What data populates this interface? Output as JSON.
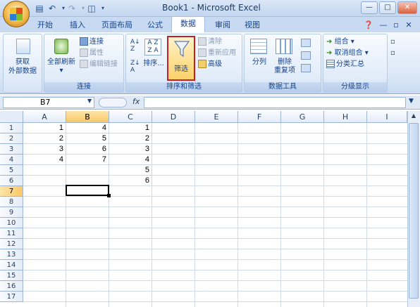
{
  "window": {
    "title": "Book1 - Microsoft Excel"
  },
  "qat": {
    "save_icon": "save-icon",
    "undo_icon": "undo-icon",
    "redo_icon": "redo-icon",
    "preview_icon": "print-preview-icon"
  },
  "tabs": [
    "开始",
    "插入",
    "页面布局",
    "公式",
    "数据",
    "审阅",
    "视图"
  ],
  "active_tab": "数据",
  "ribbon": {
    "get_external": {
      "label_line1": "获取",
      "label_line2": "外部数据"
    },
    "connections": {
      "refresh_line1": "全部刷新",
      "connections": "连接",
      "properties": "属性",
      "edit_links": "编辑链接",
      "group_label": "连接"
    },
    "sort_filter": {
      "sort": "排序...",
      "filter": "筛选",
      "clear": "清除",
      "reapply": "重新应用",
      "advanced": "高级",
      "group_label": "排序和筛选"
    },
    "data_tools": {
      "text_to_columns": "分列",
      "remove_dup_line1": "删除",
      "remove_dup_line2": "重复项",
      "group_label": "数据工具"
    },
    "outline": {
      "group": "组合",
      "ungroup": "取消组合",
      "subtotal": "分类汇总",
      "group_label": "分级显示"
    }
  },
  "formula_bar": {
    "name_box": "B7",
    "fx": "fx",
    "formula": ""
  },
  "columns": [
    "A",
    "B",
    "C",
    "D",
    "E",
    "F",
    "G",
    "H",
    "I"
  ],
  "rows": [
    "1",
    "2",
    "3",
    "4",
    "5",
    "6",
    "7",
    "8",
    "9",
    "10",
    "11",
    "12",
    "13",
    "14",
    "15",
    "16",
    "17"
  ],
  "cells": {
    "A": [
      "1",
      "2",
      "3",
      "4"
    ],
    "B": [
      "4",
      "5",
      "6",
      "7"
    ],
    "C": [
      "1",
      "2",
      "3",
      "4",
      "5",
      "6"
    ]
  },
  "selected_cell": "B7",
  "colors": {
    "highlight": "#c0202a",
    "selection": "#f9c867"
  }
}
